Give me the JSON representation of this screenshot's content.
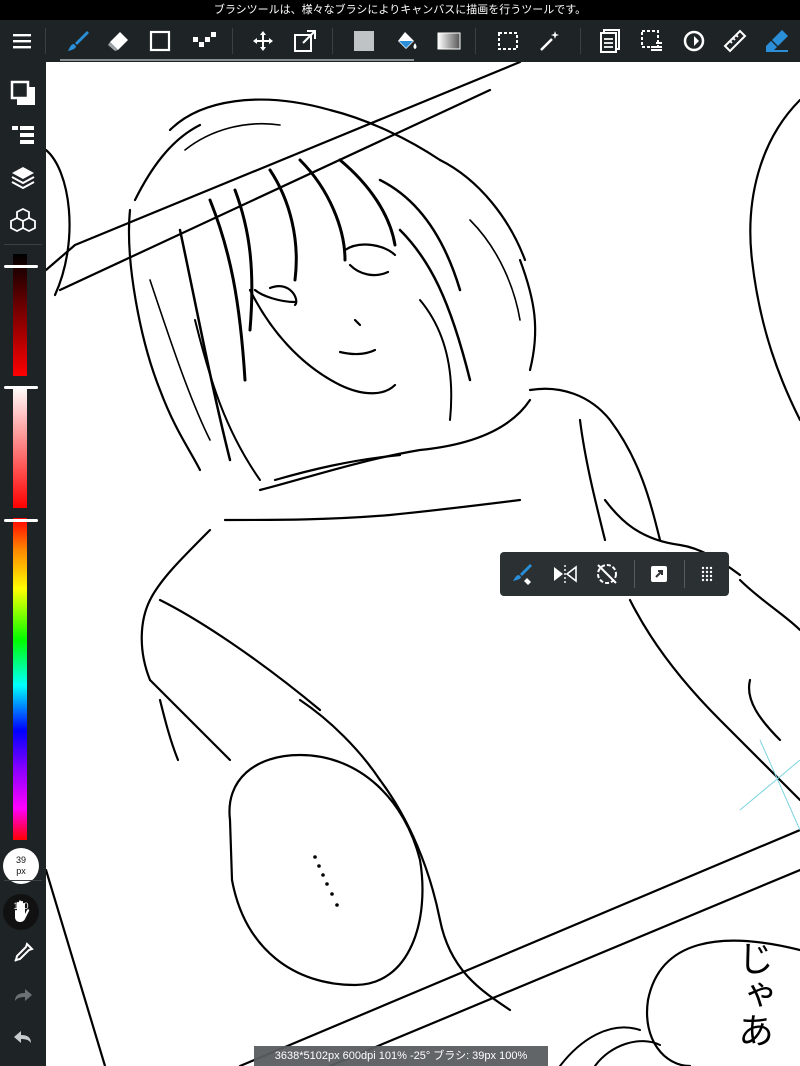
{
  "help_text": "ブラシツールは、様々なブラシによりキャンバスに描画を行うツールです。",
  "status_bar": "3638*5102px 600dpi 101% -25° ブラシ: 39px 100%",
  "brush_size": {
    "value": "39",
    "unit": "px"
  },
  "opacity": {
    "value": "100",
    "unit": "%"
  },
  "canvas_text": "じゃあ",
  "speech_dots": "……",
  "toolbar": {
    "menu": "menu-icon",
    "tools": [
      "brush",
      "eraser",
      "shape",
      "dot",
      "move",
      "transform",
      "fill-color",
      "bucket",
      "gradient",
      "select",
      "magic-wand",
      "material",
      "select-layer",
      "rotate",
      "ruler",
      "filter"
    ],
    "active_tool": "brush"
  },
  "colors": {
    "accent": "#2a8fd8",
    "panel": "#1e2326",
    "color_bar_top": "#ff0000"
  }
}
